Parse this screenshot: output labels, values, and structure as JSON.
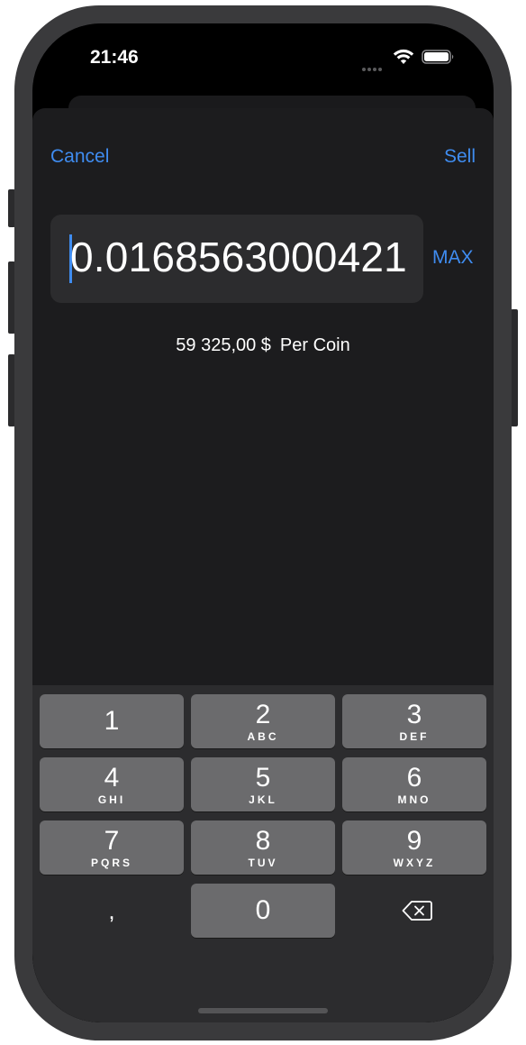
{
  "status_bar": {
    "time": "21:46",
    "wifi_icon": "wifi-icon",
    "battery_icon": "battery-icon"
  },
  "nav": {
    "cancel_label": "Cancel",
    "sell_label": "Sell"
  },
  "amount": {
    "value": "0.0168563000421",
    "max_label": "MAX"
  },
  "price": {
    "value": "59 325,00 $",
    "suffix": "Per Coin"
  },
  "keypad": {
    "keys": [
      {
        "digit": "1",
        "letters": ""
      },
      {
        "digit": "2",
        "letters": "ABC"
      },
      {
        "digit": "3",
        "letters": "DEF"
      },
      {
        "digit": "4",
        "letters": "GHI"
      },
      {
        "digit": "5",
        "letters": "JKL"
      },
      {
        "digit": "6",
        "letters": "MNO"
      },
      {
        "digit": "7",
        "letters": "PQRS"
      },
      {
        "digit": "8",
        "letters": "TUV"
      },
      {
        "digit": "9",
        "letters": "WXYZ"
      }
    ],
    "decimal_key": ",",
    "zero_key": "0",
    "delete_icon": "backspace-icon"
  },
  "colors": {
    "accent": "#3f8cf0",
    "sheet_background": "#1c1c1e",
    "field_background": "#2c2c2e",
    "key_background": "#6b6b6d"
  }
}
